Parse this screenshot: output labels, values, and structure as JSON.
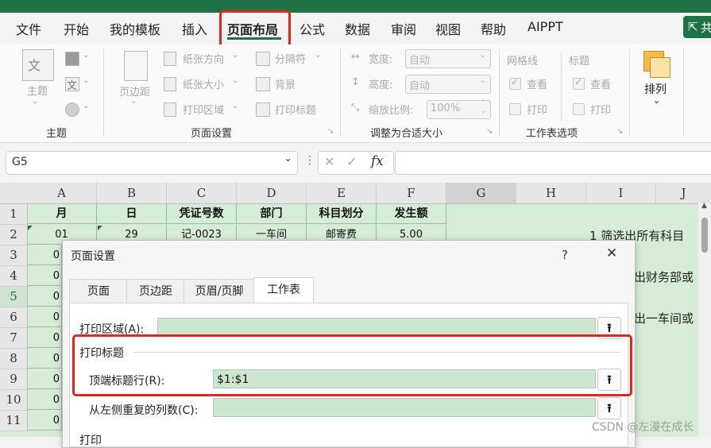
{
  "ribbon_tabs": [
    "文件",
    "开始",
    "我的模板",
    "插入",
    "页面布局",
    "公式",
    "数据",
    "审阅",
    "视图",
    "帮助",
    "AIPPT"
  ],
  "active_tab": "页面布局",
  "share_label": "共",
  "ribbon": {
    "theme": {
      "button": "主题",
      "group": "主题"
    },
    "page_setup": {
      "margins": "页边距",
      "orientation": "纸张方向",
      "size": "纸张大小",
      "print_area": "打印区域",
      "breaks": "分隔符",
      "background": "背景",
      "print_titles": "打印标题",
      "group": "页面设置"
    },
    "scale_to_fit": {
      "width_label": "宽度:",
      "width_value": "自动",
      "height_label": "高度:",
      "height_value": "自动",
      "scale_label": "缩放比例:",
      "scale_value": "100%",
      "group": "调整为合适大小"
    },
    "sheet_options": {
      "gridlines": "网格线",
      "headings": "标题",
      "view": "查看",
      "print": "打印",
      "group": "工作表选项"
    },
    "arrange": {
      "label": "排列"
    }
  },
  "formula_bar": {
    "name_box": "G5",
    "fx": "fx",
    "formula": ""
  },
  "sheet": {
    "columns": [
      "A",
      "B",
      "C",
      "D",
      "E",
      "F",
      "G",
      "H",
      "I",
      "J"
    ],
    "rows": [
      "1",
      "2",
      "3",
      "4",
      "5",
      "6",
      "7",
      "8",
      "9",
      "10",
      "11"
    ],
    "header_row": [
      "月",
      "日",
      "凭证号数",
      "部门",
      "科目划分",
      "发生额"
    ],
    "row2": [
      "01",
      "29",
      "记-0023",
      "一车间",
      "邮寄费",
      "5.00"
    ],
    "visible_a": [
      "0",
      "0",
      "0",
      "0",
      "0",
      "0",
      "0",
      "0",
      "0"
    ],
    "side_texts": [
      "1  筛选出所有科目",
      "出财务部或",
      "出一车间或"
    ]
  },
  "dialog": {
    "title": "页面设置",
    "help": "?",
    "close": "✕",
    "tabs": [
      "页面",
      "页边距",
      "页眉/页脚",
      "工作表"
    ],
    "active_tab": "工作表",
    "print_area_label": "打印区域(A):",
    "print_area_value": "",
    "print_titles_section": "打印标题",
    "rows_repeat_label": "顶端标题行(R):",
    "rows_repeat_value": "$1:$1",
    "cols_repeat_label": "从左侧重复的列数(C):",
    "cols_repeat_value": "",
    "print_section": "打印"
  },
  "watermark": "CSDN @左漫在成长",
  "colors": {
    "excel_green": "#1f7244",
    "highlight_red": "#e0261f",
    "cell_green": "#d7ecd7"
  }
}
